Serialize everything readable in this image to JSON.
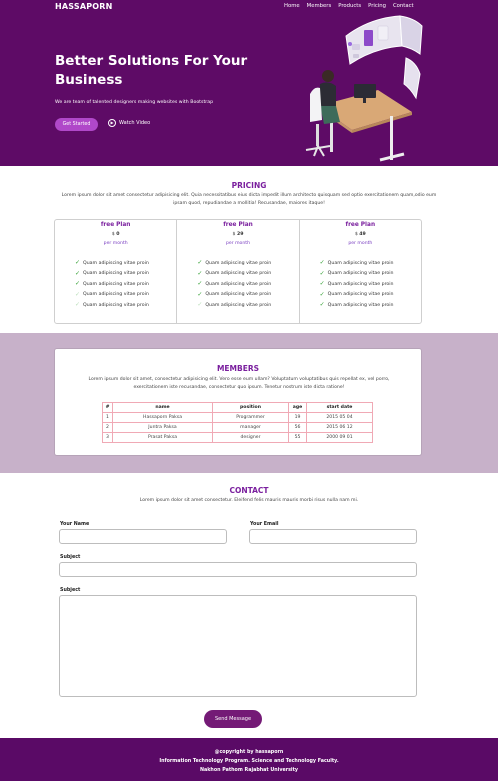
{
  "header": {
    "brand": "HASSAPORN",
    "nav": [
      "Home",
      "Members",
      "Products",
      "Pricing",
      "Contact"
    ]
  },
  "hero": {
    "title": "Better Solutions For Your Business",
    "subtitle": "We are team of talented designers making websites with Bootstrap",
    "cta_label": "Get Started",
    "watch_label": "Watch Video"
  },
  "pricing": {
    "title": "PRICING",
    "text": "Lorem ipsum dolor sit amet consectetur adipisicing elit. Quia necessitatibus eius dicta impedit illum architecto quisquam sed optio exercitationem quam,odio eum ipsam quod, repudiandae a mollitia! Recusandae, maiores itaque!",
    "plans": [
      {
        "name": "free Plan",
        "currency": "$",
        "price": "0",
        "period": "per month",
        "features": [
          "Quam adipiscing vitae proin",
          "Quam adipiscing vitae proin",
          "Quam adipiscing vitae proin",
          "Quam adipiscing vitae proin",
          "Quam adipiscing vitae proin"
        ]
      },
      {
        "name": "free Plan",
        "currency": "$",
        "price": "29",
        "period": "per month",
        "features": [
          "Quam adipiscing vitae proin",
          "Quam adipiscing vitae proin",
          "Quam adipiscing vitae proin",
          "Quam adipiscing vitae proin",
          "Quam adipiscing vitae proin"
        ]
      },
      {
        "name": "free Plan",
        "currency": "$",
        "price": "49",
        "period": "per month",
        "features": [
          "Quam adipiscing vitae proin",
          "Quam adipiscing vitae proin",
          "Quam adipiscing vitae proin",
          "Quam adipiscing vitae proin",
          "Quam adipiscing vitae proin"
        ]
      }
    ]
  },
  "members": {
    "title": "MEMBERS",
    "text": "Lorem ipsum dolor sit amet, consectetur adipisicing elit. Vero esse eum ullam? Voluptatum voluptatibus quis repellat ex, vel porro, exercitationem iste recusandae, consectetur quo ipsum. Tenetur nostrum iste dicta ratione!",
    "columns": [
      "#",
      "name",
      "position",
      "age",
      "start date"
    ],
    "rows": [
      [
        "1",
        "Hassaporn Paksa",
        "Programmer",
        "19",
        "2015 05 04"
      ],
      [
        "2",
        "Juntra Paksa",
        "manager",
        "56",
        "2015 06 12"
      ],
      [
        "3",
        "Prasat Paksa",
        "designer",
        "55",
        "2000 09 01"
      ]
    ]
  },
  "contact": {
    "title": "CONTACT",
    "text": "Lorem ipsum dolor sit amet consectetur. Eleifend felis mauris mauris morbi risus nulla nam mi.",
    "name_label": "Your Name",
    "email_label": "Your Email",
    "subject_label": "Subject",
    "message_label": "Subject",
    "send_label": "Send Message"
  },
  "footer": {
    "line1": "@copyright by hassaporn",
    "line2": "Information Technology Program. Science and Technology Faculty.",
    "line3": "Nakhon Pathom Rajabhat University"
  },
  "colors": {
    "hero_bg": "#5e0b66",
    "accent": "#7a1f9e",
    "button": "#b048c9",
    "members_bg": "#c7b1c9",
    "footer_bg": "#5a0a66"
  }
}
